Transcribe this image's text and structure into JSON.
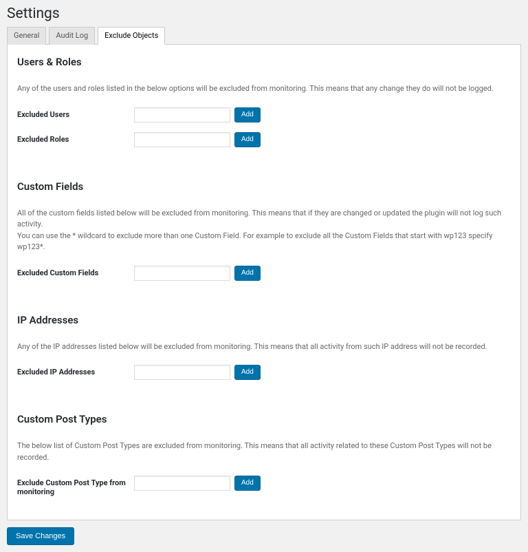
{
  "page": {
    "title": "Settings"
  },
  "tabs": {
    "general": "General",
    "audit_log": "Audit Log",
    "exclude_objects": "Exclude Objects"
  },
  "sections": {
    "users_roles": {
      "heading": "Users & Roles",
      "description": "Any of the users and roles listed in the below options will be excluded from monitoring. This means that any change they do will not be logged.",
      "fields": {
        "excluded_users": {
          "label": "Excluded Users",
          "value": "",
          "button": "Add"
        },
        "excluded_roles": {
          "label": "Excluded Roles",
          "value": "",
          "button": "Add"
        }
      }
    },
    "custom_fields": {
      "heading": "Custom Fields",
      "desc_line1": "All of the custom fields listed below will be excluded from monitoring. This means that if they are changed or updated the plugin will not log such activity.",
      "desc_line2": "You can use the * wildcard to exclude more than one Custom Field. For example to exclude all the Custom Fields that start with wp123 specify wp123*.",
      "fields": {
        "excluded_custom_fields": {
          "label": "Excluded Custom Fields",
          "value": "",
          "button": "Add"
        }
      }
    },
    "ip_addresses": {
      "heading": "IP Addresses",
      "description": "Any of the IP addresses listed below will be excluded from monitoring. This means that all activity from such IP address will not be recorded.",
      "fields": {
        "excluded_ip": {
          "label": "Excluded IP Addresses",
          "value": "",
          "button": "Add"
        }
      }
    },
    "custom_post_types": {
      "heading": "Custom Post Types",
      "description": "The below list of Custom Post Types are excluded from monitoring. This means that all activity related to these Custom Post Types will not be recorded.",
      "fields": {
        "exclude_cpt": {
          "label": "Exclude Custom Post Type from monitoring",
          "value": "",
          "button": "Add"
        }
      }
    }
  },
  "buttons": {
    "save": "Save Changes"
  }
}
